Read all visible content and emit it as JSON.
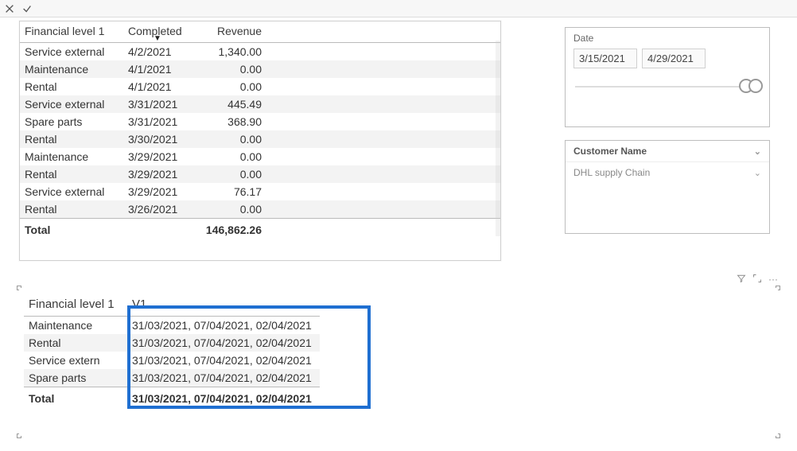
{
  "table1": {
    "headers": {
      "c0": "Financial level 1",
      "c1": "Completed",
      "c2": "Revenue"
    },
    "rows": [
      {
        "c0": "Service external",
        "c1": "4/2/2021",
        "c2": "1,340.00"
      },
      {
        "c0": "Maintenance",
        "c1": "4/1/2021",
        "c2": "0.00"
      },
      {
        "c0": "Rental",
        "c1": "4/1/2021",
        "c2": "0.00"
      },
      {
        "c0": "Service external",
        "c1": "3/31/2021",
        "c2": "445.49"
      },
      {
        "c0": "Spare parts",
        "c1": "3/31/2021",
        "c2": "368.90"
      },
      {
        "c0": "Rental",
        "c1": "3/30/2021",
        "c2": "0.00"
      },
      {
        "c0": "Maintenance",
        "c1": "3/29/2021",
        "c2": "0.00"
      },
      {
        "c0": "Rental",
        "c1": "3/29/2021",
        "c2": "0.00"
      },
      {
        "c0": "Service external",
        "c1": "3/29/2021",
        "c2": "76.17"
      },
      {
        "c0": "Rental",
        "c1": "3/26/2021",
        "c2": "0.00"
      }
    ],
    "total_label": "Total",
    "total_value": "146,862.26"
  },
  "date_slicer": {
    "title": "Date",
    "from": "3/15/2021",
    "to": "4/29/2021"
  },
  "customer_slicer": {
    "title": "Customer Name",
    "selected": "DHL supply Chain"
  },
  "table2": {
    "headers": {
      "c0": "Financial level 1",
      "c1": "V1"
    },
    "rows": [
      {
        "c0": "Maintenance",
        "c1": "31/03/2021, 07/04/2021, 02/04/2021"
      },
      {
        "c0": "Rental",
        "c1": "31/03/2021, 07/04/2021, 02/04/2021"
      },
      {
        "c0": "Service extern",
        "c1": "31/03/2021, 07/04/2021, 02/04/2021"
      },
      {
        "c0": "Spare parts",
        "c1": "31/03/2021, 07/04/2021, 02/04/2021"
      }
    ],
    "total_label": "Total",
    "total_value": "31/03/2021, 07/04/2021, 02/04/2021"
  }
}
